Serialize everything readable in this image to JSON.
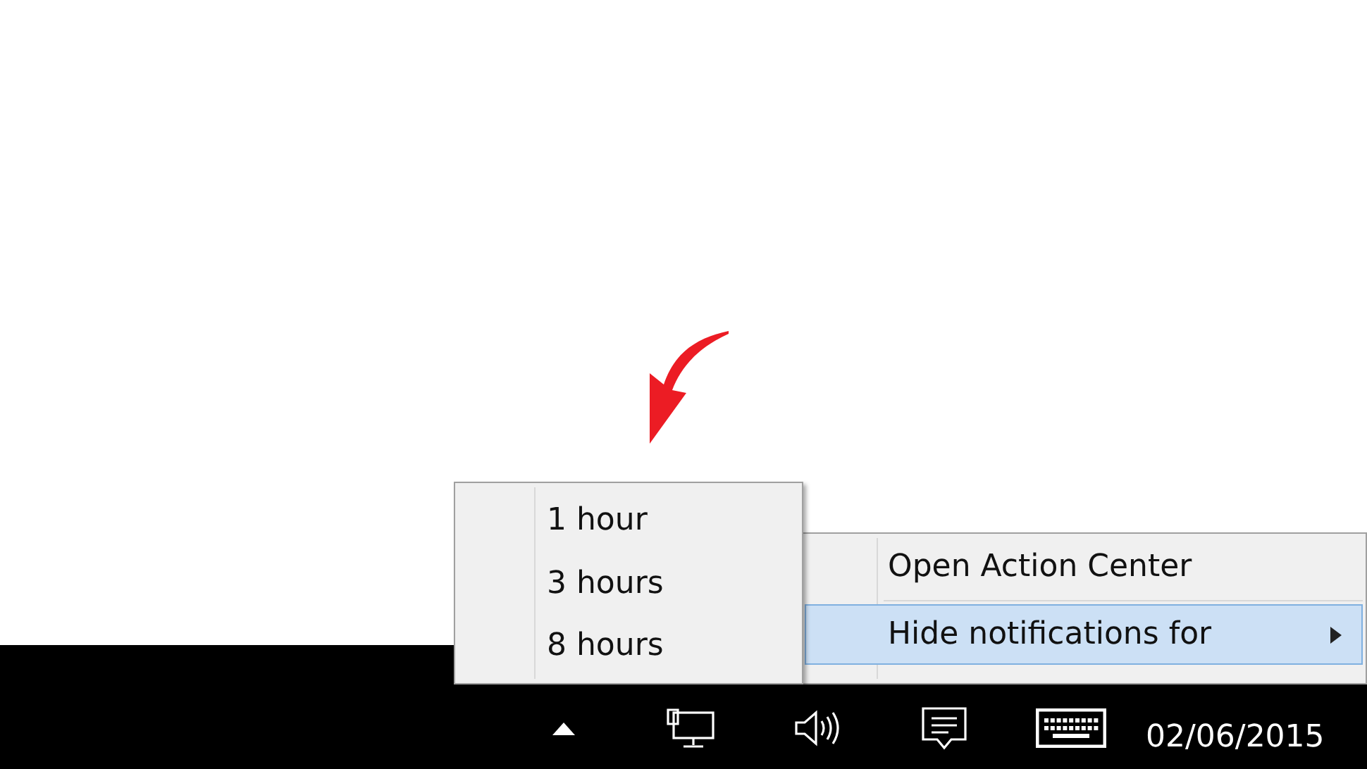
{
  "context_menu": {
    "items": [
      {
        "label": "Open Action Center",
        "selected": false,
        "submenu": false
      },
      {
        "label": "Hide notifications for",
        "selected": true,
        "submenu": true
      }
    ]
  },
  "submenu": {
    "items": [
      {
        "label": "1 hour"
      },
      {
        "label": "3 hours"
      },
      {
        "label": "8 hours"
      }
    ]
  },
  "taskbar": {
    "date": "02/06/2015"
  }
}
